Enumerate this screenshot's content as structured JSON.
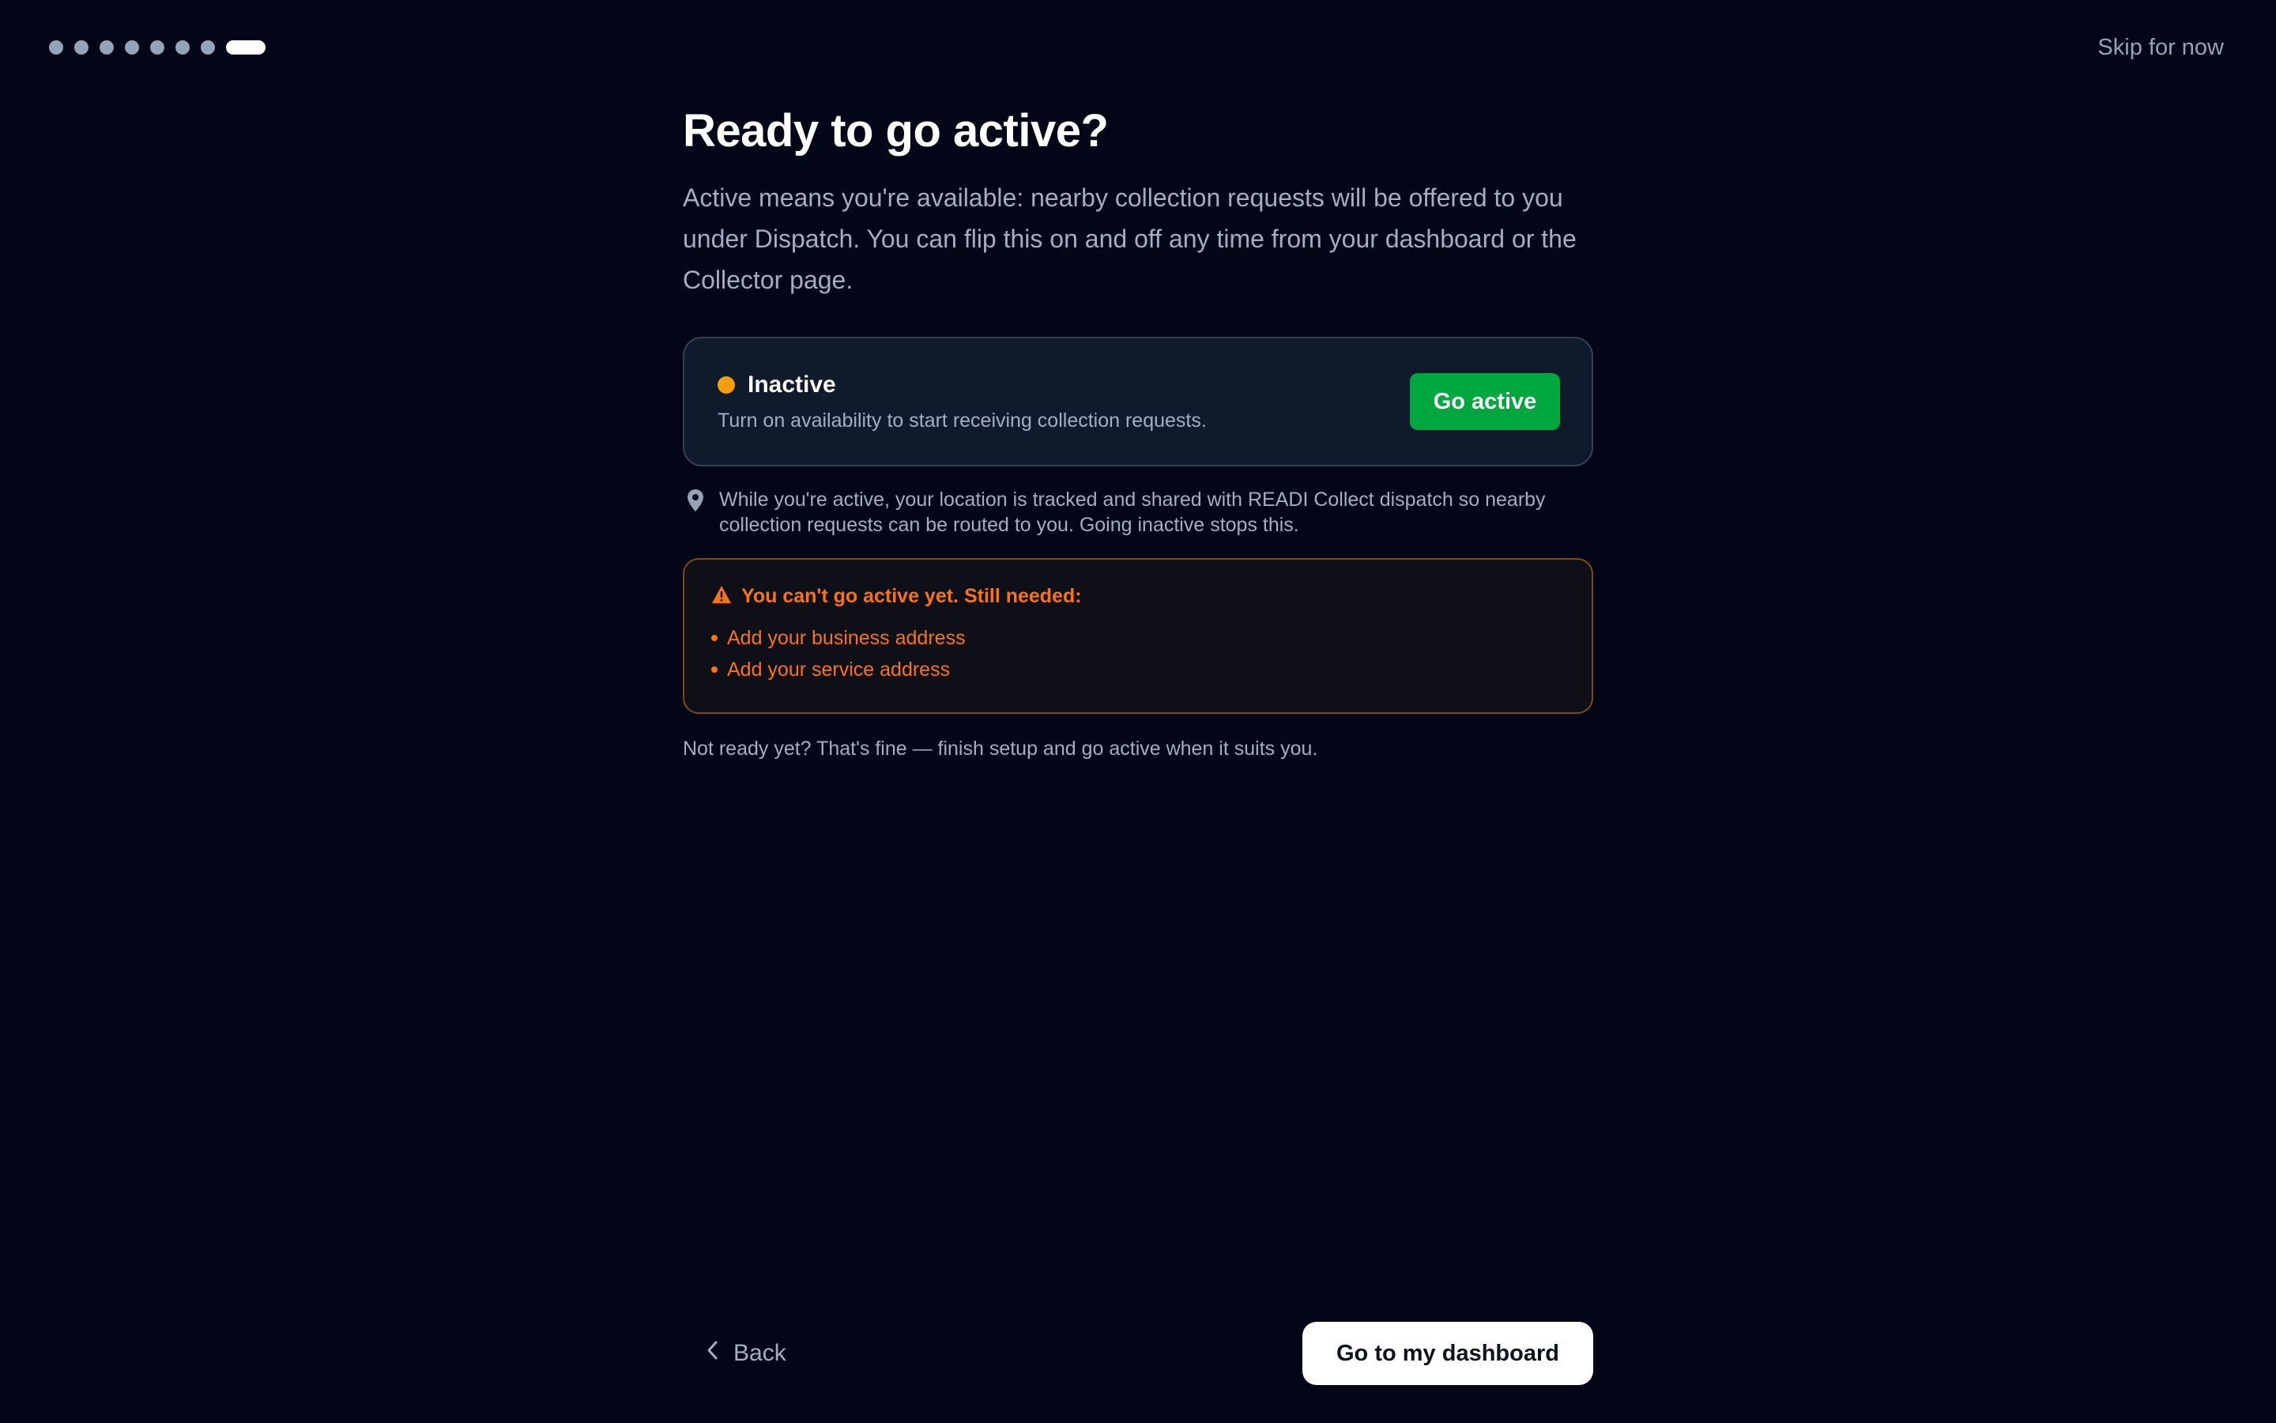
{
  "progress": {
    "total_steps": 8,
    "current_step": 8
  },
  "header": {
    "skip_label": "Skip for now"
  },
  "main": {
    "title": "Ready to go active?",
    "lead": "Active means you're available: nearby collection requests will be offered to you under Dispatch. You can flip this on and off any time from your dashboard or the Collector page.",
    "status_card": {
      "status_label": "Inactive",
      "status_color": "#f59e0b",
      "status_sub": "Turn on availability to start receiving collection requests.",
      "button_label": "Go active",
      "button_color": "#00a63e"
    },
    "location_note": {
      "icon": "map-pin-icon",
      "text": "While you're active, your location is tracked and shared with READI Collect dispatch so nearby collection requests can be routed to you. Going inactive stops this."
    },
    "warning": {
      "icon": "warning-triangle-icon",
      "title": "You can't go active yet. Still needed:",
      "items": [
        "Add your business address",
        "Add your service address"
      ],
      "color": "#f97316"
    },
    "not_ready": "Not ready yet? That's fine — finish setup and go active when it suits you."
  },
  "footer": {
    "back_label": "Back",
    "primary_label": "Go to my dashboard"
  }
}
